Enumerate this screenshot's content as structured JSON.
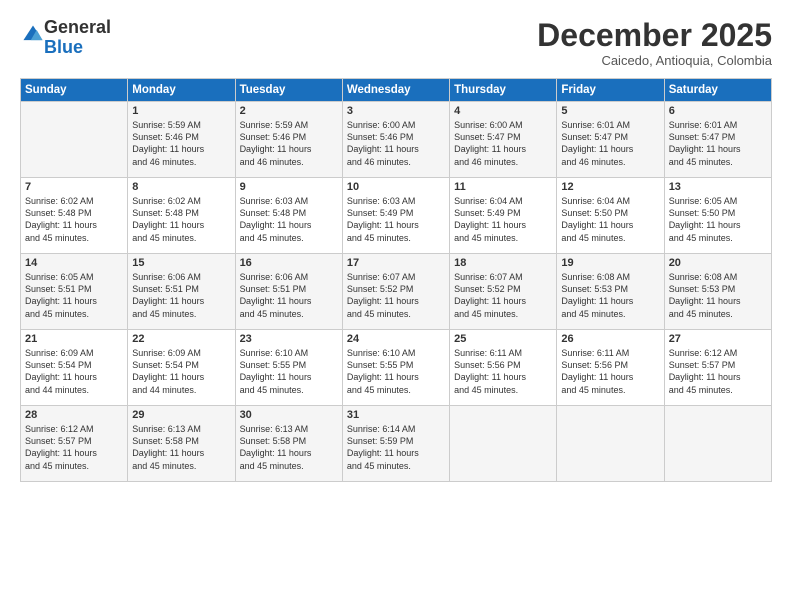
{
  "logo": {
    "general": "General",
    "blue": "Blue"
  },
  "title": "December 2025",
  "location": "Caicedo, Antioquia, Colombia",
  "weekdays": [
    "Sunday",
    "Monday",
    "Tuesday",
    "Wednesday",
    "Thursday",
    "Friday",
    "Saturday"
  ],
  "weeks": [
    [
      {
        "day": "",
        "info": ""
      },
      {
        "day": "1",
        "info": "Sunrise: 5:59 AM\nSunset: 5:46 PM\nDaylight: 11 hours\nand 46 minutes."
      },
      {
        "day": "2",
        "info": "Sunrise: 5:59 AM\nSunset: 5:46 PM\nDaylight: 11 hours\nand 46 minutes."
      },
      {
        "day": "3",
        "info": "Sunrise: 6:00 AM\nSunset: 5:46 PM\nDaylight: 11 hours\nand 46 minutes."
      },
      {
        "day": "4",
        "info": "Sunrise: 6:00 AM\nSunset: 5:47 PM\nDaylight: 11 hours\nand 46 minutes."
      },
      {
        "day": "5",
        "info": "Sunrise: 6:01 AM\nSunset: 5:47 PM\nDaylight: 11 hours\nand 46 minutes."
      },
      {
        "day": "6",
        "info": "Sunrise: 6:01 AM\nSunset: 5:47 PM\nDaylight: 11 hours\nand 45 minutes."
      }
    ],
    [
      {
        "day": "7",
        "info": "Sunrise: 6:02 AM\nSunset: 5:48 PM\nDaylight: 11 hours\nand 45 minutes."
      },
      {
        "day": "8",
        "info": "Sunrise: 6:02 AM\nSunset: 5:48 PM\nDaylight: 11 hours\nand 45 minutes."
      },
      {
        "day": "9",
        "info": "Sunrise: 6:03 AM\nSunset: 5:48 PM\nDaylight: 11 hours\nand 45 minutes."
      },
      {
        "day": "10",
        "info": "Sunrise: 6:03 AM\nSunset: 5:49 PM\nDaylight: 11 hours\nand 45 minutes."
      },
      {
        "day": "11",
        "info": "Sunrise: 6:04 AM\nSunset: 5:49 PM\nDaylight: 11 hours\nand 45 minutes."
      },
      {
        "day": "12",
        "info": "Sunrise: 6:04 AM\nSunset: 5:50 PM\nDaylight: 11 hours\nand 45 minutes."
      },
      {
        "day": "13",
        "info": "Sunrise: 6:05 AM\nSunset: 5:50 PM\nDaylight: 11 hours\nand 45 minutes."
      }
    ],
    [
      {
        "day": "14",
        "info": "Sunrise: 6:05 AM\nSunset: 5:51 PM\nDaylight: 11 hours\nand 45 minutes."
      },
      {
        "day": "15",
        "info": "Sunrise: 6:06 AM\nSunset: 5:51 PM\nDaylight: 11 hours\nand 45 minutes."
      },
      {
        "day": "16",
        "info": "Sunrise: 6:06 AM\nSunset: 5:51 PM\nDaylight: 11 hours\nand 45 minutes."
      },
      {
        "day": "17",
        "info": "Sunrise: 6:07 AM\nSunset: 5:52 PM\nDaylight: 11 hours\nand 45 minutes."
      },
      {
        "day": "18",
        "info": "Sunrise: 6:07 AM\nSunset: 5:52 PM\nDaylight: 11 hours\nand 45 minutes."
      },
      {
        "day": "19",
        "info": "Sunrise: 6:08 AM\nSunset: 5:53 PM\nDaylight: 11 hours\nand 45 minutes."
      },
      {
        "day": "20",
        "info": "Sunrise: 6:08 AM\nSunset: 5:53 PM\nDaylight: 11 hours\nand 45 minutes."
      }
    ],
    [
      {
        "day": "21",
        "info": "Sunrise: 6:09 AM\nSunset: 5:54 PM\nDaylight: 11 hours\nand 44 minutes."
      },
      {
        "day": "22",
        "info": "Sunrise: 6:09 AM\nSunset: 5:54 PM\nDaylight: 11 hours\nand 44 minutes."
      },
      {
        "day": "23",
        "info": "Sunrise: 6:10 AM\nSunset: 5:55 PM\nDaylight: 11 hours\nand 45 minutes."
      },
      {
        "day": "24",
        "info": "Sunrise: 6:10 AM\nSunset: 5:55 PM\nDaylight: 11 hours\nand 45 minutes."
      },
      {
        "day": "25",
        "info": "Sunrise: 6:11 AM\nSunset: 5:56 PM\nDaylight: 11 hours\nand 45 minutes."
      },
      {
        "day": "26",
        "info": "Sunrise: 6:11 AM\nSunset: 5:56 PM\nDaylight: 11 hours\nand 45 minutes."
      },
      {
        "day": "27",
        "info": "Sunrise: 6:12 AM\nSunset: 5:57 PM\nDaylight: 11 hours\nand 45 minutes."
      }
    ],
    [
      {
        "day": "28",
        "info": "Sunrise: 6:12 AM\nSunset: 5:57 PM\nDaylight: 11 hours\nand 45 minutes."
      },
      {
        "day": "29",
        "info": "Sunrise: 6:13 AM\nSunset: 5:58 PM\nDaylight: 11 hours\nand 45 minutes."
      },
      {
        "day": "30",
        "info": "Sunrise: 6:13 AM\nSunset: 5:58 PM\nDaylight: 11 hours\nand 45 minutes."
      },
      {
        "day": "31",
        "info": "Sunrise: 6:14 AM\nSunset: 5:59 PM\nDaylight: 11 hours\nand 45 minutes."
      },
      {
        "day": "",
        "info": ""
      },
      {
        "day": "",
        "info": ""
      },
      {
        "day": "",
        "info": ""
      }
    ]
  ]
}
